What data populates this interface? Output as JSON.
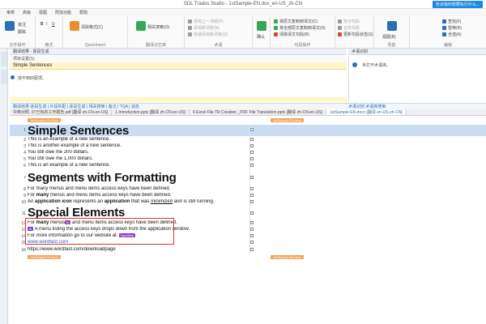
{
  "window": {
    "title": "SDL Trados Studio - 1stSample-EN.dox_en-US_zh-CN",
    "cloud_button": "告诉我你想要执行什么..."
  },
  "menu": [
    "审校",
    "高级",
    "视图",
    "附加功能",
    "帮助"
  ],
  "ribbon": {
    "groups": [
      {
        "caption": "文件操作",
        "items": [
          "批注",
          "跟踪"
        ]
      },
      {
        "caption": "格式",
        "items": [
          "B",
          "I",
          "U"
        ]
      },
      {
        "caption": "QuickInsert",
        "items": [
          "清除格式(C)"
        ]
      },
      {
        "caption": "翻译记忆库",
        "items": [
          "相关搜索(O)"
        ]
      },
      {
        "caption": "术语",
        "items": [
          "添加上一词组(P)",
          "添加新词条(N)",
          "快速添加新词条(Q)"
        ]
      },
      {
        "caption": "",
        "items": [
          "确认"
        ]
      },
      {
        "caption": "句段操作",
        "items": [
          "将原文复制到译文(C)",
          "将全部原文复制到译文(S)",
          "清除译文句段(R)"
        ]
      },
      {
        "caption": "",
        "items": [
          "拆分句段",
          "合并句段",
          "更新句段状态(S)"
        ]
      },
      {
        "caption": "导航",
        "items": [
          "视图(B)"
        ]
      },
      {
        "caption": "编辑",
        "items": [
          "查找(F)",
          "替换(R)",
          "全选(A)"
        ]
      }
    ]
  },
  "panes": {
    "tm_header": "翻译结果 - 逐段生成",
    "tm_toolbar": "项目设置(S)",
    "tm_source": "Simple Sentences",
    "tm_target": "找不到匹配项。",
    "right_header": "术语识别",
    "right_note": "未打开术语库。"
  },
  "midbar": {
    "left": "翻译结果  逐段生成 | 片段匹配 | 逐段生成 | 相关搜索 | 备注 | TQA | 消息",
    "right": "术语识别   术语库搜索"
  },
  "doc_tabs": [
    "中英对照, 07已有的工作报告.pdf [翻译 zh-CN-en-US]",
    "1 Introduction.pptx [翻译 zh-CN-en-US]",
    "6 Excel File TR Creation _PDF File Translation.pptx [翻译 zh-CN-en-US]",
    "1stSample-EN.docx [翻译 en-US-zh-CN]"
  ],
  "file_tags": {
    "top_left": "1stSample-EN.docx",
    "top_right": "1stSample-EN.docx",
    "bottom_left": "1stSample-EN.docx",
    "bottom_right": "1stSample-EN.docx"
  },
  "segments": [
    {
      "n": "1",
      "text": "Simple Sentences"
    },
    {
      "n": "2",
      "text": "This is an example of a new sentence."
    },
    {
      "n": "3",
      "text": "This is another example of a new sentence."
    },
    {
      "n": "4",
      "text": "You still owe me 200 dollars."
    },
    {
      "n": "5",
      "text": "You still owe me 1,000 dollars."
    },
    {
      "n": "6",
      "text": "This is an example of a new sentence."
    },
    {
      "n": "7",
      "text": "Segments with Formatting"
    },
    {
      "n": "8",
      "text": "For many menus and menu items access keys have been defined."
    },
    {
      "n": "9",
      "text_a": "For ",
      "bold": "many",
      "text_b": " menus and menu items access keys have been defined."
    },
    {
      "n": "10",
      "text_a": "An ",
      "bold": "application icon",
      "text_b": " represents an ",
      "bold2": "application",
      "text_c": " that was ",
      "underline": "minimized",
      "text_d": " and is still running."
    },
    {
      "n": "11",
      "text": "Special Elements"
    },
    {
      "n": "12",
      "text_a": "For ",
      "bold": "many",
      "text_b": " menus",
      "tag": "fn",
      "text_c": " and menu items access keys have been defined."
    },
    {
      "n": "13",
      "tag": "fn",
      "text": " A menu listing the access keys drops down from the application window."
    },
    {
      "n": "14",
      "text": "For more information go to our website at: ",
      "tag": "hyperlink"
    },
    {
      "n": "15",
      "link": "www.wordfast.com"
    },
    {
      "n": "16",
      "text": "https://www.wordfast.com/downloadpage"
    }
  ]
}
